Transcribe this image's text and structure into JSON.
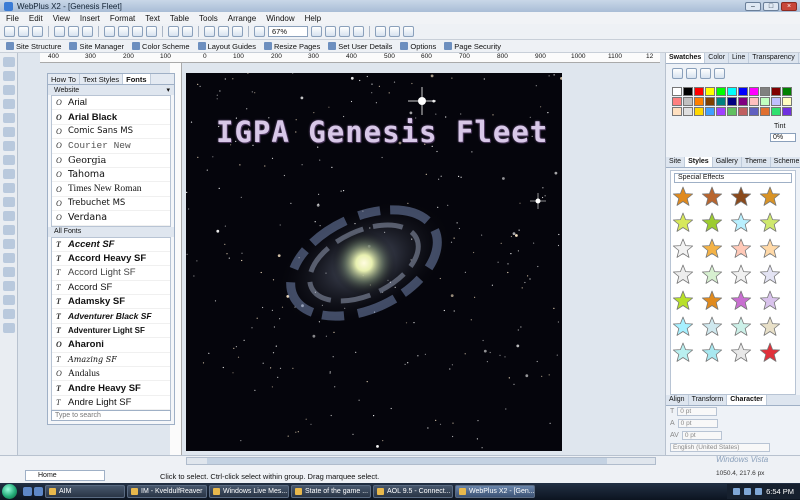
{
  "window": {
    "title": "WebPlus X2 - [Genesis Fleet]"
  },
  "menu": [
    "File",
    "Edit",
    "View",
    "Insert",
    "Format",
    "Text",
    "Table",
    "Tools",
    "Arrange",
    "Window",
    "Help"
  ],
  "toolbar": {
    "zoom": "67%"
  },
  "context_toolbar": [
    "Site Structure",
    "Site Manager",
    "Color Scheme",
    "Layout Guides",
    "Resize Pages",
    "Set User Details",
    "Options",
    "Page Security"
  ],
  "ruler": {
    "labels": [
      "400",
      "300",
      "200",
      "100",
      "0",
      "100",
      "200",
      "300",
      "400",
      "500",
      "600",
      "700",
      "800",
      "900",
      "1000",
      "1100",
      "12"
    ]
  },
  "font_panel": {
    "tabs": [
      "How To",
      "Text Styles",
      "Fonts"
    ],
    "website_label": "Website",
    "website_fonts": [
      "Arial",
      "Arial Black",
      "Comic Sans MS",
      "Courier New",
      "Georgia",
      "Tahoma",
      "Times New Roman",
      "Trebuchet MS",
      "Verdana"
    ],
    "all_label": "All Fonts",
    "all_fonts": [
      "Accent SF",
      "Accord Heavy SF",
      "Accord Light SF",
      "Accord SF",
      "Adamsky SF",
      "Adventurer Black SF",
      "Adventurer Light SF",
      "Aharoni",
      "Amazing SF",
      "Andalus",
      "Andre Heavy SF",
      "Andre Light SF"
    ],
    "search_placeholder": "Type to search"
  },
  "canvas": {
    "headline": "IGPA Genesis Fleet"
  },
  "right_panel": {
    "top_tabs": [
      "Swatches",
      "Color",
      "Line",
      "Transparency"
    ],
    "tint_label": "Tint",
    "tint_value": "0%",
    "mid_tabs": [
      "Site",
      "Styles",
      "Gallery",
      "Theme",
      "Scheme"
    ],
    "effect_select": "Special Effects",
    "swatch_colors": [
      "#ffffff",
      "#000000",
      "#ff0000",
      "#ffff00",
      "#00ff00",
      "#00ffff",
      "#0000ff",
      "#ff00ff",
      "#808080",
      "#800000",
      "#008000",
      "#ff8080",
      "#c0c0c0",
      "#ff8000",
      "#804000",
      "#008080",
      "#000080",
      "#800080",
      "#ffc0c0",
      "#c0ffc0",
      "#c0c0ff",
      "#ffffc0",
      "#ffe0c0",
      "#e0e0e0",
      "#ffd700",
      "#40a0ff",
      "#a040ff",
      "#60c060",
      "#c06060",
      "#6060c0",
      "#e07030",
      "#30e070",
      "#7030e0"
    ],
    "star_colors": [
      "#e08a1e",
      "#b8652e",
      "#8a4a1c",
      "#d89326",
      "#d7e85a",
      "#9ccc2f",
      "#b9f0ff",
      "#cfe86e",
      "#f2f2f2",
      "#f3b246",
      "#ffc9b8",
      "#ffd9a8",
      "#ededed",
      "#d7f0d0",
      "#f0f0f0",
      "#e3e3f3",
      "#b8e02a",
      "#e08a1e",
      "#c86fd0",
      "#d9c3ec",
      "#a7f0ff",
      "#cfe8ee",
      "#ccf0e8",
      "#e8e0c8",
      "#b9f0f0",
      "#a8e8f0",
      "#e8e8e8",
      "#e0303a"
    ],
    "bottom_tabs": [
      "Align",
      "Transform",
      "Character"
    ],
    "char_fields": [
      "0 pt",
      "0 pt",
      "0 pt"
    ],
    "language": "English (United States)"
  },
  "status": {
    "home": "Home",
    "message": "Click to select. Ctrl-click select within group. Drag marquee select.",
    "coords": "1050.4, 217.6 px"
  },
  "taskbar": {
    "tasks": [
      "AIM",
      "IM - KveldulfReaver",
      "Windows Live Mes...",
      "State of the game ...",
      "AOL 9.5 - Connect...",
      "WebPlus X2 - [Gen..."
    ],
    "active_index": 5,
    "clock": "6:54 PM"
  },
  "watermark": "Windows Vista"
}
